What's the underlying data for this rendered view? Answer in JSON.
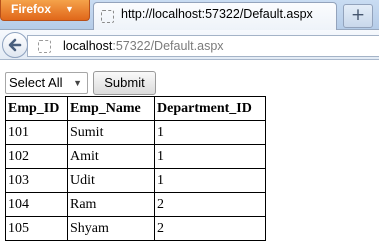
{
  "browser": {
    "menu_button_label": "Firefox",
    "tab_title": "http://localhost:57322/Default.aspx",
    "new_tab_label": "+",
    "url_host": "localhost",
    "url_path": ":57322/Default.aspx"
  },
  "form": {
    "select_value": "Select All",
    "submit_label": "Submit"
  },
  "table": {
    "headers": [
      "Emp_ID",
      "Emp_Name",
      "Department_ID"
    ],
    "rows": [
      [
        "101",
        "Sumit",
        "1"
      ],
      [
        "102",
        "Amit",
        "1"
      ],
      [
        "103",
        "Udit",
        "1"
      ],
      [
        "104",
        "Ram",
        "2"
      ],
      [
        "105",
        "Shyam",
        "2"
      ]
    ]
  },
  "colors": {
    "firefox_orange": "#e0671a",
    "chrome_blue": "#c9dcf2"
  },
  "icons": {
    "back": "back-arrow-icon",
    "favicon": "blank-page-icon",
    "dropdown": "chevron-down-icon"
  }
}
